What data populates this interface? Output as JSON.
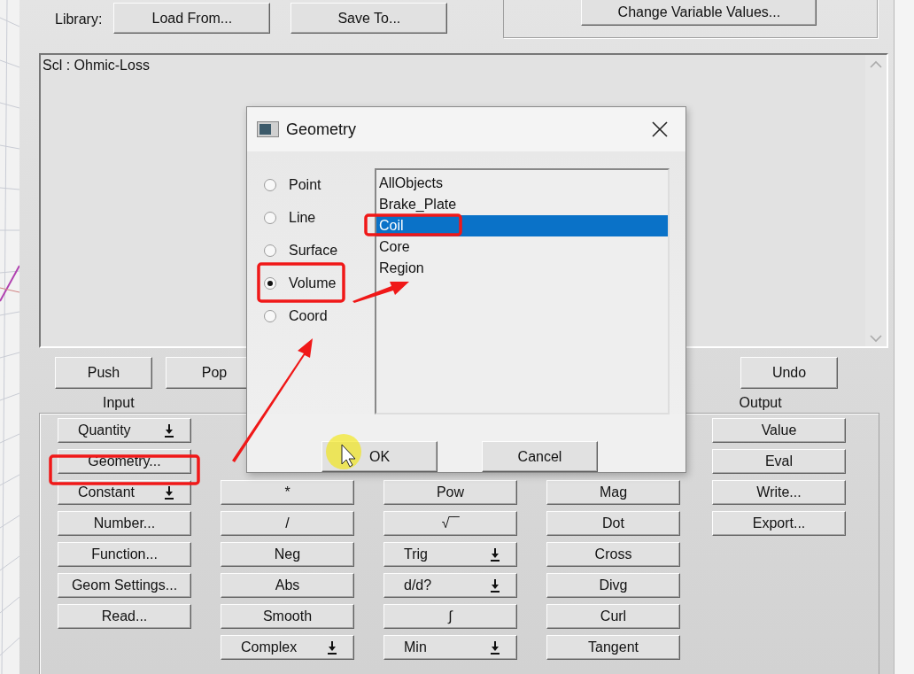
{
  "library": {
    "label": "Library:",
    "buttons": [
      "Load From...",
      "Save To..."
    ]
  },
  "variables_button": "Change Variable Values...",
  "stack": {
    "lines": [
      "Scl : Ohmic-Loss"
    ]
  },
  "stack_buttons": [
    "Push",
    "Pop",
    "Undo"
  ],
  "input_label": "Input",
  "output_label": "Output",
  "calculator": {
    "columns": [
      [
        {
          "label": "Quantity",
          "kind": "dropdown"
        },
        {
          "label": "Geometry...",
          "kind": "plain"
        },
        {
          "label": "Constant",
          "kind": "dropdown"
        },
        {
          "label": "Number...",
          "kind": "plain"
        },
        {
          "label": "Function...",
          "kind": "plain"
        },
        {
          "label": "Geom Settings...",
          "kind": "plain"
        },
        {
          "label": "Read...",
          "kind": "plain"
        }
      ],
      [
        null,
        null,
        {
          "label": "*",
          "kind": "plain"
        },
        {
          "label": "/",
          "kind": "plain"
        },
        {
          "label": "Neg",
          "kind": "plain"
        },
        {
          "label": "Abs",
          "kind": "plain"
        },
        {
          "label": "Smooth",
          "kind": "plain"
        },
        {
          "label": "Complex",
          "kind": "dropdown"
        }
      ],
      [
        null,
        null,
        {
          "label": "Pow",
          "kind": "plain"
        },
        {
          "label": "√‾‾",
          "kind": "plain"
        },
        {
          "label": "Trig",
          "kind": "dropdown"
        },
        {
          "label": "d/d?",
          "kind": "dropdown"
        },
        {
          "label": "∫",
          "kind": "plain"
        },
        {
          "label": "Min",
          "kind": "dropdown"
        }
      ],
      [
        null,
        null,
        {
          "label": "Mag",
          "kind": "plain"
        },
        {
          "label": "Dot",
          "kind": "plain"
        },
        {
          "label": "Cross",
          "kind": "plain"
        },
        {
          "label": "Divg",
          "kind": "plain"
        },
        {
          "label": "Curl",
          "kind": "plain"
        },
        {
          "label": "Tangent",
          "kind": "plain"
        }
      ],
      [
        {
          "label": "Value",
          "kind": "plain"
        },
        {
          "label": "Eval",
          "kind": "plain"
        },
        {
          "label": "Write...",
          "kind": "plain"
        },
        {
          "label": "Export...",
          "kind": "plain"
        }
      ]
    ]
  },
  "dialog": {
    "title": "Geometry",
    "types": [
      {
        "label": "Point",
        "selected": false
      },
      {
        "label": "Line",
        "selected": false
      },
      {
        "label": "Surface",
        "selected": false
      },
      {
        "label": "Volume",
        "selected": true
      },
      {
        "label": "Coord",
        "selected": false
      }
    ],
    "objects": [
      {
        "label": "AllObjects",
        "selected": false
      },
      {
        "label": "Brake_Plate",
        "selected": false
      },
      {
        "label": "Coil",
        "selected": true
      },
      {
        "label": "Core",
        "selected": false
      },
      {
        "label": "Region",
        "selected": false
      }
    ],
    "buttons": [
      "OK",
      "Cancel"
    ]
  }
}
